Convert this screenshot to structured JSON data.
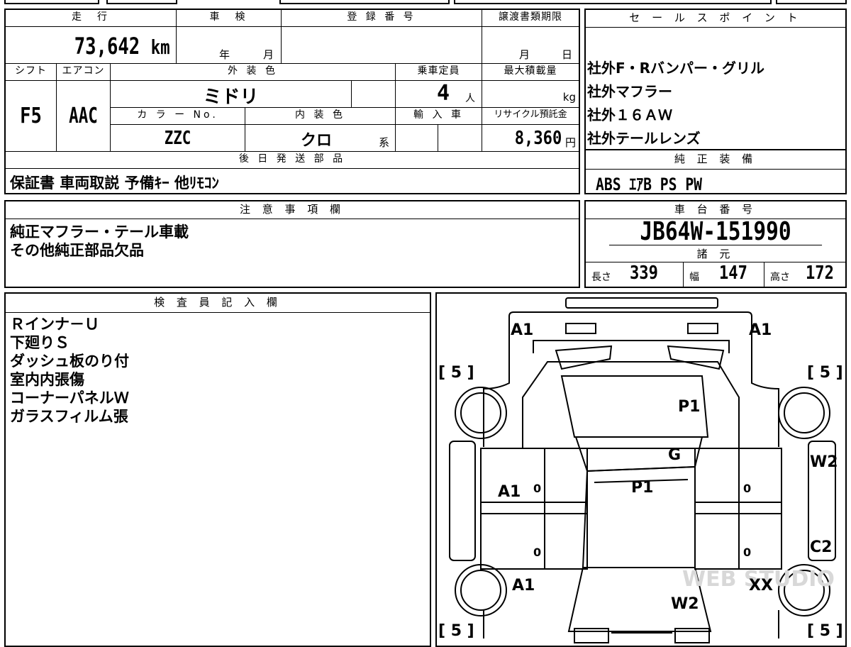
{
  "vehicle_info": {
    "mileage_label": "走　行",
    "mileage_value": "73,642",
    "mileage_unit": "km",
    "inspection_label": "車　検",
    "inspection_year_unit": "年",
    "inspection_month_unit": "月",
    "registration_label": "登 録 番 号",
    "transfer_deadline_label": "譲渡書類期限",
    "transfer_month_unit": "月",
    "transfer_day_unit": "日",
    "shift_label": "シフト",
    "shift_value": "F5",
    "aircon_label": "エアコン",
    "aircon_value": "AAC",
    "exterior_color_label": "外 装 色",
    "exterior_color_value": "ミドリ",
    "capacity_label": "乗車定員",
    "capacity_value": "4",
    "capacity_unit": "人",
    "max_load_label": "最大積載量",
    "max_load_unit": "kg",
    "color_no_label": "カ ラ ー No.",
    "color_no_value": "ZZC",
    "interior_color_label": "内 装 色",
    "interior_color_value": "クロ",
    "interior_color_suffix": "系",
    "import_label": "輸 入 車",
    "recycle_label": "リサイクル預託金",
    "recycle_value": "8,360",
    "recycle_unit": "円",
    "later_parts_label": "後 日 発 送 部 品",
    "later_parts_value": "保証書 車両取説 予備ｷｰ 他ﾘﾓｺﾝ"
  },
  "sales_points": {
    "label": "セ ー ル ス ポ イ ン ト",
    "items": [
      "社外F・Rバンパー・グリル",
      "社外マフラー",
      "社外１６ＡＷ",
      "社外テールレンズ"
    ]
  },
  "genuine_equipment": {
    "label": "純 正 装 備",
    "value": "ABS ｴｱB PS PW"
  },
  "caution": {
    "label": "注 意 事 項 欄",
    "lines": [
      "純正マフラー・テール車載",
      "その他純正部品欠品"
    ]
  },
  "chassis": {
    "label": "車 台 番 号",
    "value": "JB64W-151990",
    "spec_label": "諸 元",
    "length_label": "長さ",
    "length_value": "339",
    "width_label": "幅",
    "width_value": "147",
    "height_label": "高さ",
    "height_value": "172"
  },
  "inspector": {
    "label": "検 査 員 記 入 欄",
    "lines": [
      "Ｒインナ－Ｕ",
      "下廻りＳ",
      "ダッシュ板のり付",
      "室内内張傷",
      "コーナーパネルＷ",
      "ガラスフィルム張"
    ]
  },
  "diagram_marks": {
    "front_left": "A1",
    "front_right": "A1",
    "bracket_tl": "[ 5 ]",
    "bracket_tr": "[ 5 ]",
    "bracket_bl": "[ 5 ]",
    "bracket_br": "[ 5 ]",
    "hood": "P1",
    "windshield": "G",
    "roof": "P1",
    "left_front_door": "A1",
    "right_front_door": "W2",
    "right_rear": "C2",
    "left_rear": "A1",
    "rear_right": "XX",
    "rear_center": "W2",
    "zero_a": "0",
    "zero_b": "0",
    "zero_c": "0",
    "zero_d": "0"
  },
  "watermark": "WEB STUDIO"
}
